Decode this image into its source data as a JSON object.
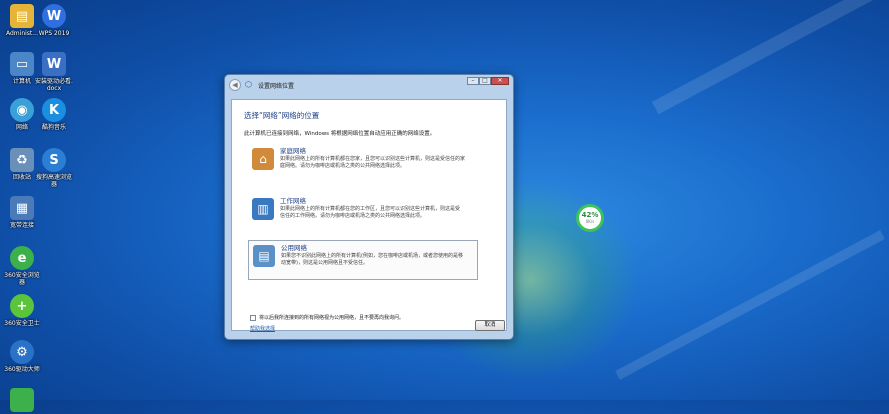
{
  "desktop": {
    "icons": [
      {
        "label": "Administ...",
        "icon": "user-folder-icon",
        "color": "#e6b437"
      },
      {
        "label": "WPS 2019",
        "icon": "wps-icon",
        "color": "#2f6fe0"
      },
      {
        "label": "计算机",
        "icon": "computer-icon",
        "color": "#4a86c8"
      },
      {
        "label": "安装驱动必看.\ndocx",
        "icon": "word-doc-icon",
        "color": "#3b6fc4"
      },
      {
        "label": "网络",
        "icon": "network-icon",
        "color": "#3aa0d8"
      },
      {
        "label": "酷狗音乐",
        "icon": "kugou-icon",
        "color": "#1a8ee0"
      },
      {
        "label": "回收站",
        "icon": "recycle-bin-icon",
        "color": "#6a8fb8"
      },
      {
        "label": "搜狗高速浏览\n器",
        "icon": "sogou-browser-icon",
        "color": "#2a7fd4"
      },
      {
        "label": "宽带连接",
        "icon": "broadband-icon",
        "color": "#4a7ab8"
      },
      {
        "label": "360安全浏览\n器",
        "icon": "360-browser-icon",
        "color": "#3cb04a"
      },
      {
        "label": "360安全卫士",
        "icon": "360-guard-icon",
        "color": "#5ac43a"
      },
      {
        "label": "360驱动大师",
        "icon": "360-driver-icon",
        "color": "#2a72c8"
      }
    ]
  },
  "battery_widget": {
    "percent": "42%",
    "sub": "0K/s"
  },
  "dialog": {
    "title": "设置网络位置",
    "heading": "选择“网络”网络的位置",
    "intro": "此计算机已连接到网络，Windows 将根据网络位置自动应用正确的网络设置。",
    "options": [
      {
        "title": "家庭网络",
        "icon": "home-network-icon",
        "description": "如果此网络上的所有计算机都在您家，且您可以识别这些计算机，则这是受信任的家\n庭网络。请勿为咖啡店或机场之类的公共网络选择此项。",
        "selected": false
      },
      {
        "title": "工作网络",
        "icon": "work-network-icon",
        "description": "如果此网络上的所有计算机都在您的工作区，且您可以识别这些计算机，则这是受\n信任的工作网络。请勿为咖啡店或机场之类的公共网络选择此项。",
        "selected": false
      },
      {
        "title": "公用网络",
        "icon": "public-network-icon",
        "description": "如果您不识别此网络上的所有计算机(例如，您在咖啡店或机场，或者您使用的是移\n动宽带)，则这是公用网络且不受信任。",
        "selected": true
      }
    ],
    "checkbox_label": "将以后我所连接到的所有网络视为公用网络，且不要再向我询问。",
    "help_link": "帮助我选择",
    "cancel_label": "取消"
  }
}
